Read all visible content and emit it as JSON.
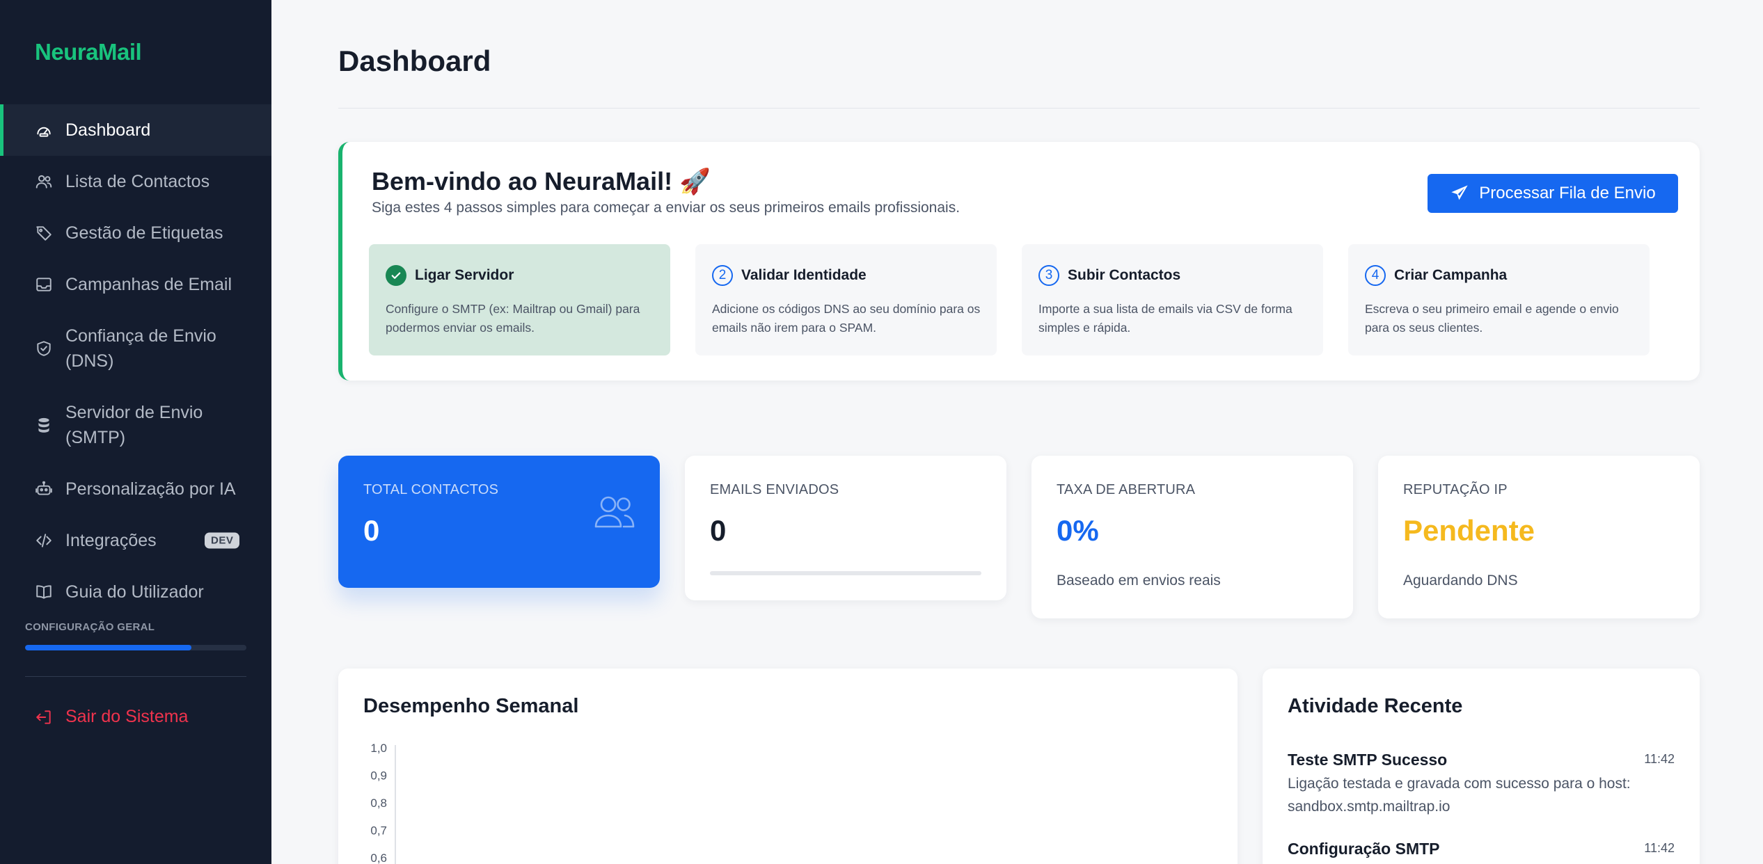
{
  "brand": {
    "name": "NeuraMail",
    "accent": "#19c37d",
    "primary": "#1668f0"
  },
  "sidebar": {
    "items": [
      {
        "label": "Dashboard",
        "icon": "gauge-icon",
        "active": true
      },
      {
        "label": "Lista de Contactos",
        "icon": "users-icon"
      },
      {
        "label": "Gestão de Etiquetas",
        "icon": "tag-icon"
      },
      {
        "label": "Campanhas de Email",
        "icon": "inbox-icon"
      },
      {
        "label": "Confiança de Envio (DNS)",
        "icon": "shield-icon"
      },
      {
        "label": "Servidor de Envio (SMTP)",
        "icon": "database-icon"
      },
      {
        "label": "Personalização por IA",
        "icon": "robot-icon"
      },
      {
        "label": "Integrações",
        "icon": "code-icon",
        "badge": "DEV"
      },
      {
        "label": "Guia do Utilizador",
        "icon": "book-icon"
      }
    ],
    "config": {
      "label": "CONFIGURAÇÃO GERAL",
      "progress_fraction": 0.75
    },
    "logout_label": "Sair do Sistema"
  },
  "header": {
    "title": "Dashboard"
  },
  "welcome": {
    "title": "Bem-vindo ao NeuraMail! 🚀",
    "subtitle": "Siga estes 4 passos simples para começar a enviar os seus primeiros emails profissionais.",
    "cta_label": "Processar Fila de Envio",
    "steps": [
      {
        "num": "✓",
        "title": "Ligar Servidor",
        "desc": "Configure o SMTP (ex: Mailtrap ou Gmail) para podermos enviar os emails.",
        "done": true
      },
      {
        "num": "2",
        "title": "Validar Identidade",
        "desc": "Adicione os códigos DNS ao seu domínio para os emails não irem para o SPAM.",
        "done": false
      },
      {
        "num": "3",
        "title": "Subir Contactos",
        "desc": "Importe a sua lista de emails via CSV de forma simples e rápida.",
        "done": false
      },
      {
        "num": "4",
        "title": "Criar Campanha",
        "desc": "Escreva o seu primeiro email e agende o envio para os seus clientes.",
        "done": false
      }
    ]
  },
  "stats": [
    {
      "label": "TOTAL CONTACTOS",
      "value": "0"
    },
    {
      "label": "EMAILS ENVIADOS",
      "value": "0",
      "progress_fraction": 0
    },
    {
      "label": "TAXA DE ABERTURA",
      "value": "0%",
      "note": "Baseado em envios reais"
    },
    {
      "label": "REPUTAÇÃO IP",
      "value": "Pendente",
      "note": "Aguardando DNS"
    }
  ],
  "weekly": {
    "title": "Desempenho Semanal"
  },
  "chart_data": {
    "type": "line",
    "title": "Desempenho Semanal",
    "xlabel": "",
    "ylabel": "",
    "ylim": [
      0,
      1
    ],
    "y_ticks": [
      "1,0",
      "0,9",
      "0,8",
      "0,7",
      "0,6"
    ],
    "series": []
  },
  "activity": {
    "title": "Atividade Recente",
    "items": [
      {
        "title": "Teste SMTP Sucesso",
        "time": "11:42",
        "desc": "Ligação testada e gravada com sucesso para o host: sandbox.smtp.mailtrap.io"
      },
      {
        "title": "Configuração SMTP",
        "time": "11:42",
        "desc": ""
      }
    ]
  }
}
